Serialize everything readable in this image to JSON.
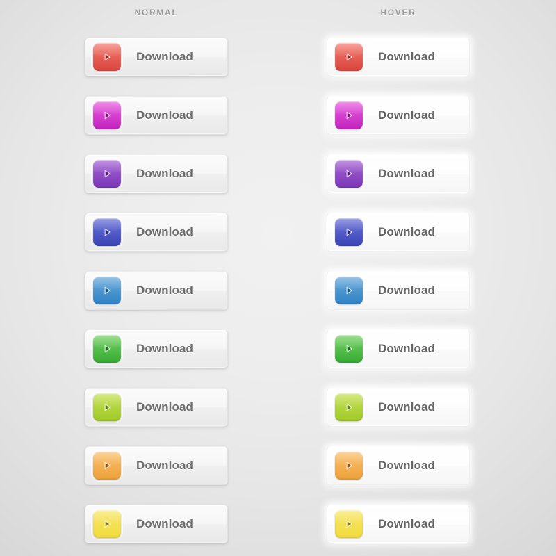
{
  "page": {
    "background_center": "#f1f1f1",
    "background_edge": "#d2d2d2"
  },
  "columns": [
    {
      "key": "normal",
      "header": "NORMAL"
    },
    {
      "key": "hover",
      "header": "HOVER"
    }
  ],
  "button": {
    "label": "Download",
    "icon": "play-icon"
  },
  "variants": [
    {
      "name": "red",
      "top": "#f0675e",
      "bottom": "#d8453c",
      "ring": "#f5a9a2",
      "arrow": "#8e1d17"
    },
    {
      "name": "magenta",
      "top": "#e濃",
      "bottom": "#c224bd",
      "ring": "#eea6ec",
      "arrow": "#79086f"
    },
    {
      "name": "purple",
      "top": "#a濃",
      "bottom": "#7b35b8",
      "ring": "#cfa8e6",
      "arrow": "#4b1175"
    },
    {
      "name": "indigo",
      "top": "#6濃",
      "bottom": "#3a43b5",
      "ring": "#a6acea",
      "arrow": "#1b2070"
    },
    {
      "name": "blue",
      "top": "#6濃",
      "bottom": "#2f82c4",
      "ring": "#a8cdec",
      "arrow": "#0f4a78"
    },
    {
      "name": "green",
      "top": "#7濃",
      "bottom": "#35ab33",
      "ring": "#a9e5a3",
      "arrow": "#156811"
    },
    {
      "name": "lime",
      "top": "#c濃",
      "bottom": "#9fc927",
      "ring": "#dcefa0",
      "arrow": "#5b7a0c"
    },
    {
      "name": "orange",
      "top": "#f濃",
      "bottom": "#eda13a",
      "ring": "#f8d9a6",
      "arrow": "#8a5206"
    },
    {
      "name": "yellow",
      "top": "#f濃",
      "bottom": "#f0da3c",
      "ring": "#faf0a8",
      "arrow": "#8a7a05"
    }
  ]
}
